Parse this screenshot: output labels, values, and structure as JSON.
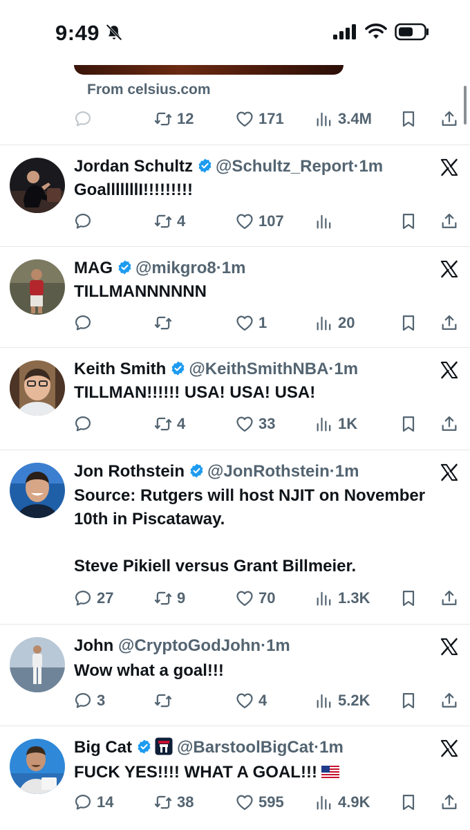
{
  "status_bar": {
    "time": "9:49"
  },
  "promo": {
    "source_text": "From celsius.com",
    "actions": {
      "replies": "",
      "retweets": "12",
      "likes": "171",
      "views": "3.4M"
    }
  },
  "tweets": [
    {
      "name": "Jordan Schultz",
      "handle": "@Schultz_Report",
      "dot": "·",
      "time": "1m",
      "text": "GoalllllllI!!!!!!!!!",
      "replies": "",
      "retweets": "4",
      "likes": "107",
      "views": ""
    },
    {
      "name": "MAG",
      "handle": "@mikgro8",
      "dot": "·",
      "time": "1m",
      "text": "TILLMANNNNNN",
      "replies": "",
      "retweets": "",
      "likes": "1",
      "views": "20"
    },
    {
      "name": "Keith Smith",
      "handle": "@KeithSmithNBA",
      "dot": "·",
      "time": "1m",
      "text": "TILLMAN!!!!!!  USA! USA! USA!",
      "replies": "",
      "retweets": "4",
      "likes": "33",
      "views": "1K"
    },
    {
      "name": "Jon Rothstein",
      "handle": "@JonRothstein",
      "dot": "·",
      "time": "1m",
      "text": "Source: Rutgers will host NJIT on November 10th in Piscataway.\n\nSteve Pikiell versus Grant Billmeier.",
      "replies": "27",
      "retweets": "9",
      "likes": "70",
      "views": "1.3K"
    },
    {
      "name": "John",
      "handle": "@CryptoGodJohn",
      "dot": "·",
      "time": "1m",
      "text": "Wow what a goal!!!",
      "replies": "3",
      "retweets": "",
      "likes": "4",
      "views": "5.2K"
    },
    {
      "name": "Big Cat",
      "handle": "@BarstoolBigCat",
      "dot": "·",
      "time": "1m",
      "text": "FUCK YES!!!! WHAT A GOAL!!!",
      "replies": "14",
      "retweets": "38",
      "likes": "595",
      "views": "4.9K"
    }
  ],
  "colors": {
    "text_primary": "#0f1419",
    "text_secondary": "#536471",
    "verified_blue": "#1d9bf0",
    "divider": "#e7e7e7"
  },
  "icons": {
    "reply": "reply-icon",
    "retweet": "retweet-icon",
    "like": "heart-icon",
    "views": "views-icon",
    "bookmark": "bookmark-icon",
    "share": "share-icon",
    "verified": "verified-badge-icon",
    "close": "x-logo-icon"
  }
}
